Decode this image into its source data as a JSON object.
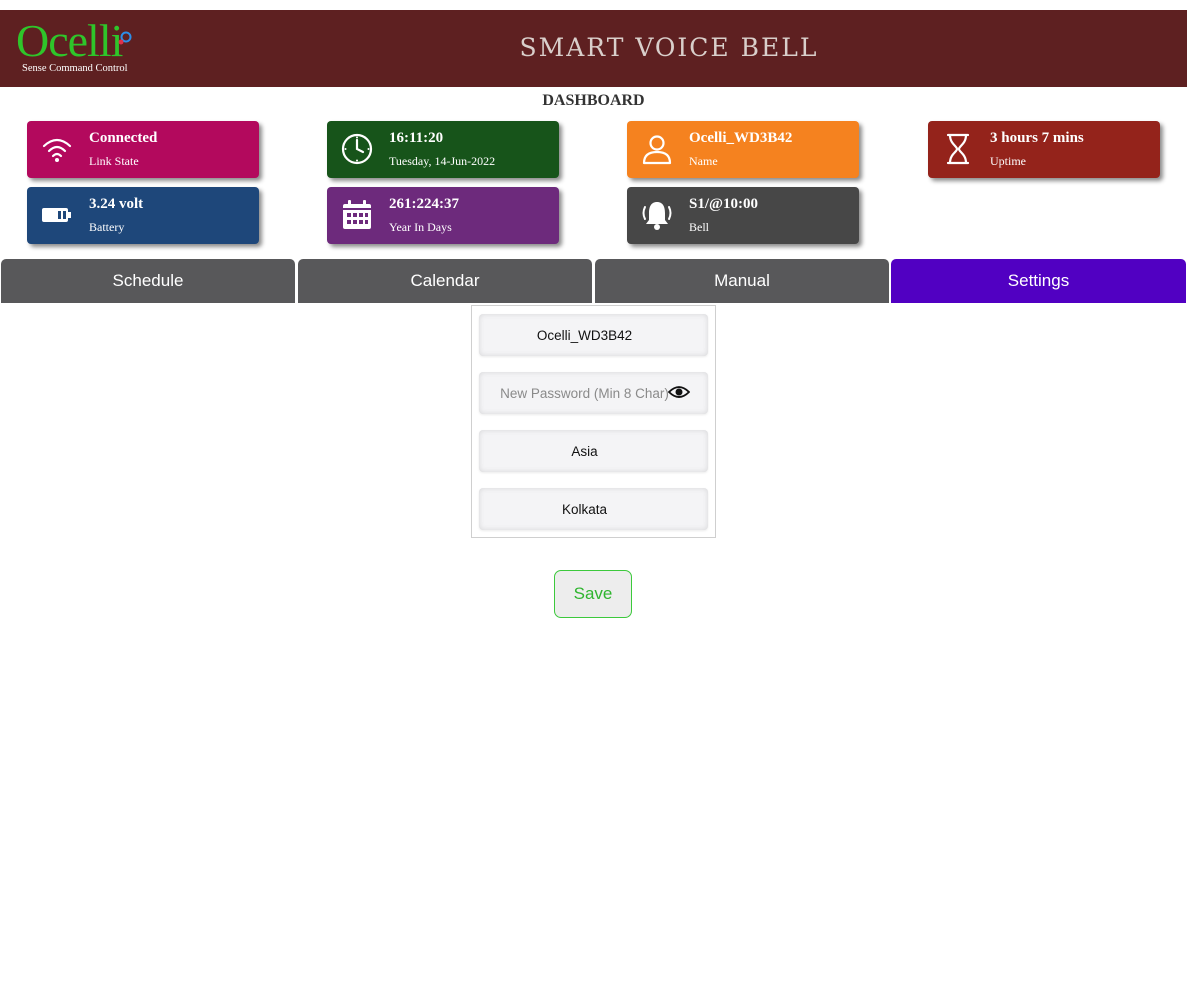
{
  "header": {
    "logo_text": "Ocelli",
    "logo_tagline": "Sense Command Control",
    "app_title": "SMART VOICE BELL",
    "colors": {
      "header_bg": "#5e2021",
      "logo_green": "#2fc52a"
    }
  },
  "dashboard": {
    "title": "DASHBOARD",
    "cards": [
      {
        "value": "Connected",
        "label": "Link State",
        "icon": "wifi-icon",
        "color": "#b3095d"
      },
      {
        "value": "16:11:20",
        "label": "Tuesday, 14-Jun-2022",
        "icon": "clock-icon",
        "color": "#17541a"
      },
      {
        "value": "Ocelli_WD3B42",
        "label": "Name",
        "icon": "user-icon",
        "color": "#f5821f"
      },
      {
        "value": "3 hours 7 mins",
        "label": "Uptime",
        "icon": "hourglass-icon",
        "color": "#94231b"
      },
      {
        "value": "3.24 volt",
        "label": "Battery",
        "icon": "battery-icon",
        "color": "#1e477a"
      },
      {
        "value": "261:224:37",
        "label": "Year In Days",
        "icon": "calendar-icon",
        "color": "#6d2a7c"
      },
      {
        "value": "S1/@10:00",
        "label": "Bell",
        "icon": "bell-icon",
        "color": "#474747"
      }
    ]
  },
  "tabs": [
    {
      "label": "Schedule",
      "active": false
    },
    {
      "label": "Calendar",
      "active": false
    },
    {
      "label": "Manual",
      "active": false
    },
    {
      "label": "Settings",
      "active": true
    }
  ],
  "settings": {
    "device_name": "Ocelli_WD3B42",
    "password_placeholder": "New Password (Min 8 Char)",
    "region": "Asia",
    "city": "Kolkata",
    "save_label": "Save",
    "colors": {
      "active_tab": "#5100c2",
      "tab": "#58585a",
      "save_accent": "#3cc93c"
    }
  }
}
